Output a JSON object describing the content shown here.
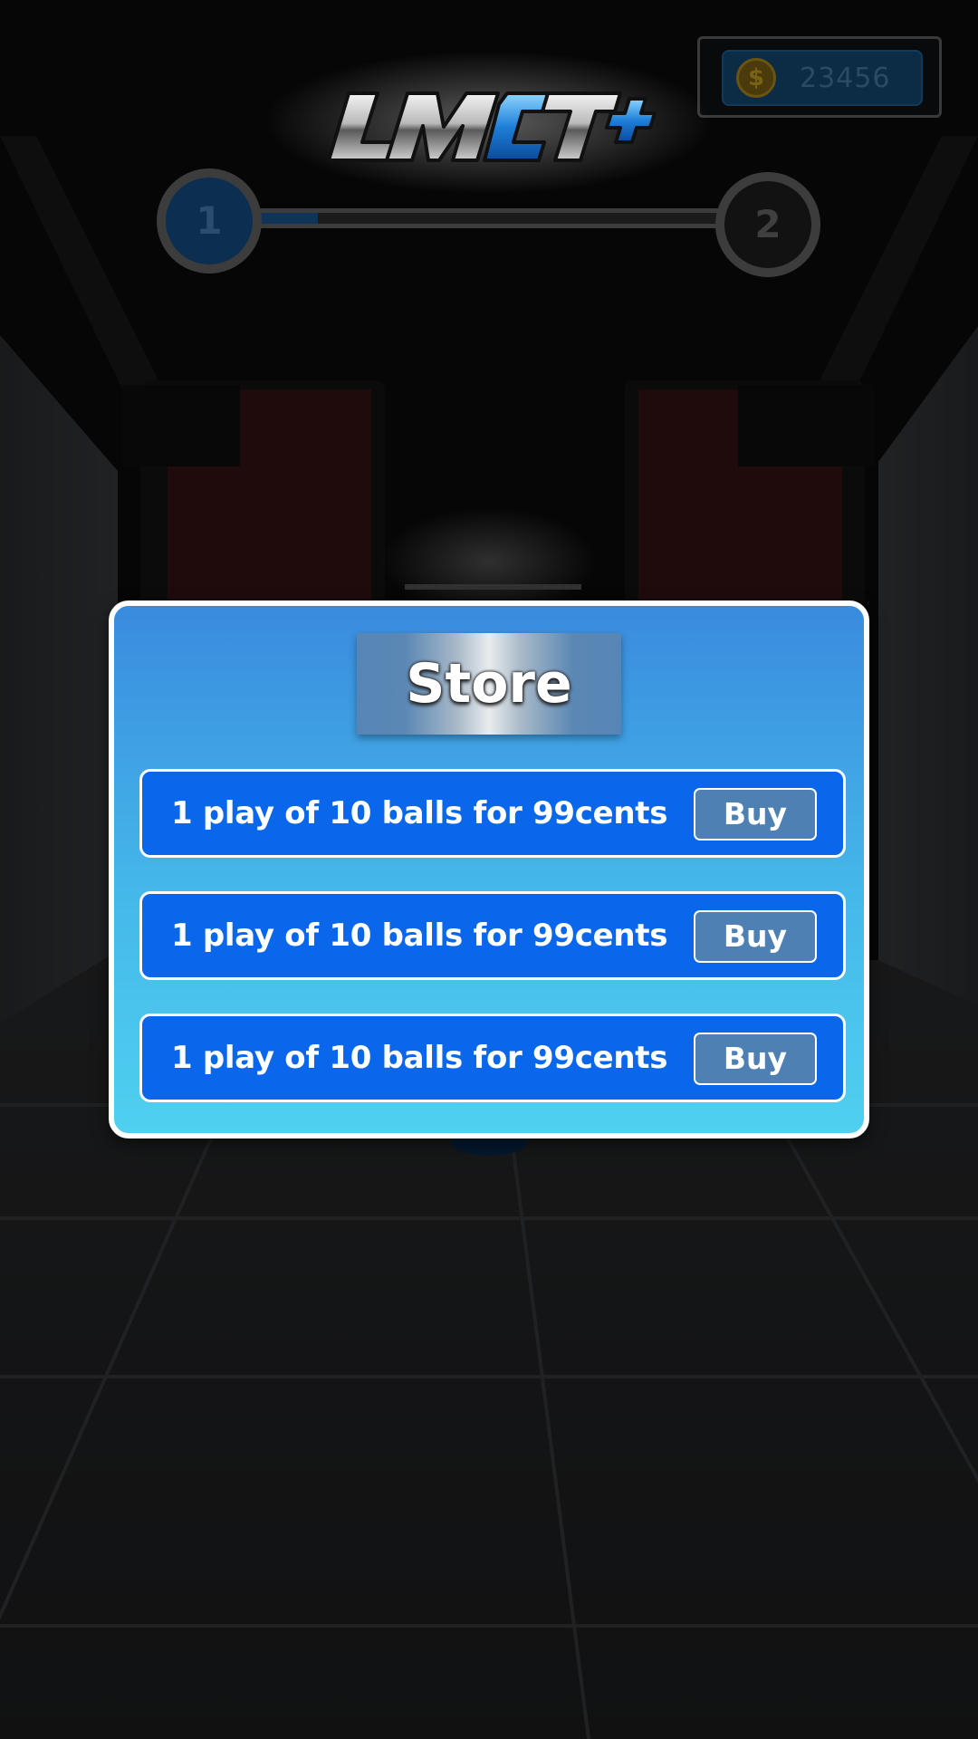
{
  "hud": {
    "coins": "23456",
    "coin_icon": "dollar-coin-icon",
    "coin_symbol": "$",
    "logo_text": "LMCT+",
    "level": {
      "current": "1",
      "next": "2",
      "progress": 0.15
    }
  },
  "store": {
    "title": "Store",
    "offers": [
      {
        "label": "1 play of 10 balls for 99cents",
        "button": "Buy"
      },
      {
        "label": "1 play of 10 balls for 99cents",
        "button": "Buy"
      },
      {
        "label": "1 play of 10 balls for 99cents",
        "button": "Buy"
      }
    ]
  },
  "colors": {
    "modal_top": "#3a8bde",
    "modal_bottom": "#4fd0f0",
    "offer_bg": "#0a66ea",
    "buy_bg": "#4f80b4"
  }
}
